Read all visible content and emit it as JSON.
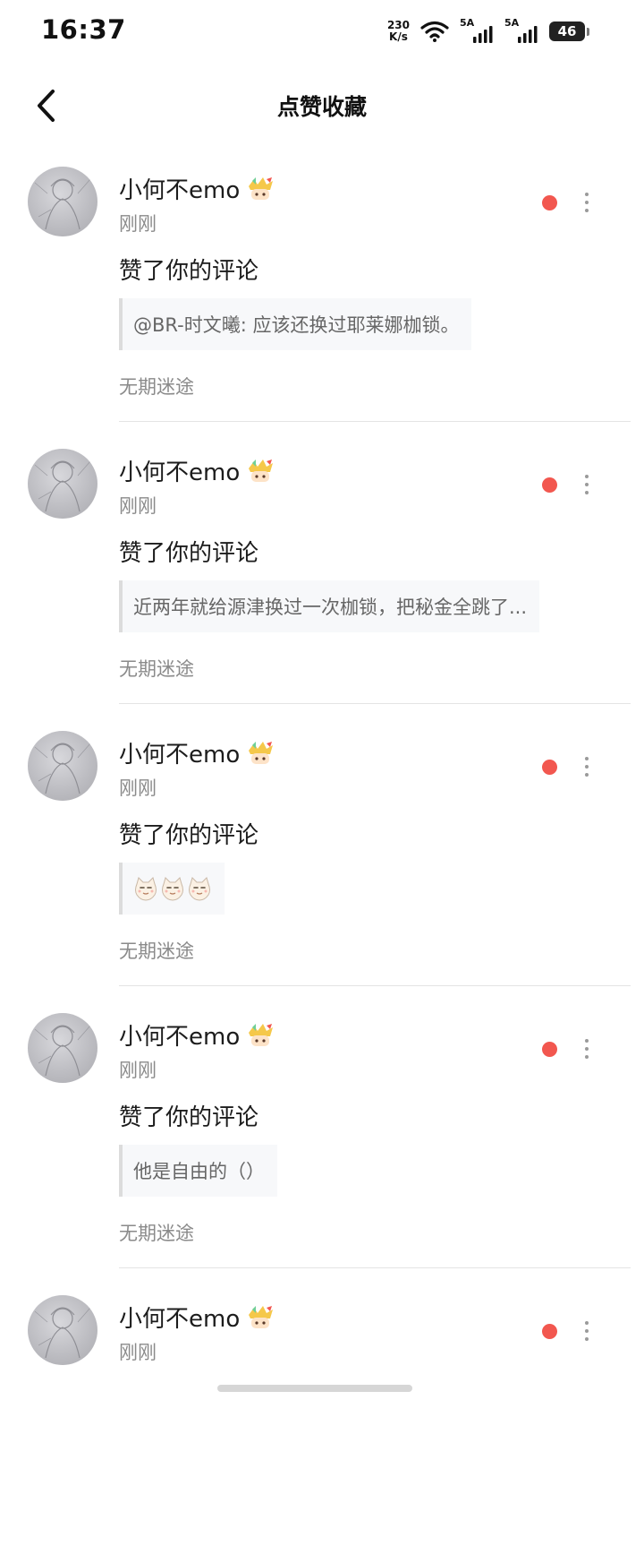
{
  "status_bar": {
    "time": "16:37",
    "net_speed_value": "230",
    "net_speed_unit": "K/s",
    "signal1_tag": "5A",
    "signal2_tag": "5A",
    "battery": "46"
  },
  "header": {
    "title": "点赞收藏"
  },
  "notifications": [
    {
      "user": "小何不emo",
      "time": "刚刚",
      "action": "赞了你的评论",
      "quote": "@BR-时文曦: 应该还换过耶莱娜枷锁。",
      "quote_type": "text",
      "source": "无期迷途"
    },
    {
      "user": "小何不emo",
      "time": "刚刚",
      "action": "赞了你的评论",
      "quote": "近两年就给源津换过一次枷锁，把秘金全跳了...",
      "quote_type": "text",
      "source": "无期迷途"
    },
    {
      "user": "小何不emo",
      "time": "刚刚",
      "action": "赞了你的评论",
      "quote": "",
      "quote_type": "emoji",
      "emoji_count": 3,
      "emoji_icon": "cat-face-emoji-icon",
      "source": "无期迷途"
    },
    {
      "user": "小何不emo",
      "time": "刚刚",
      "action": "赞了你的评论",
      "quote": "他是自由的（）",
      "quote_type": "text",
      "source": "无期迷途"
    },
    {
      "user": "小何不emo",
      "time": "刚刚"
    }
  ],
  "colors": {
    "unread_dot": "#f2574f",
    "secondary_text": "#8a8a8a",
    "quote_bg": "#f7f8fa",
    "divider": "#e4e4e4"
  },
  "icons": {
    "back": "chevron-left-icon",
    "more": "more-vertical-icon",
    "badge": "user-badge-icon",
    "wifi": "wifi-icon",
    "signal": "signal-icon",
    "battery": "battery-icon"
  }
}
